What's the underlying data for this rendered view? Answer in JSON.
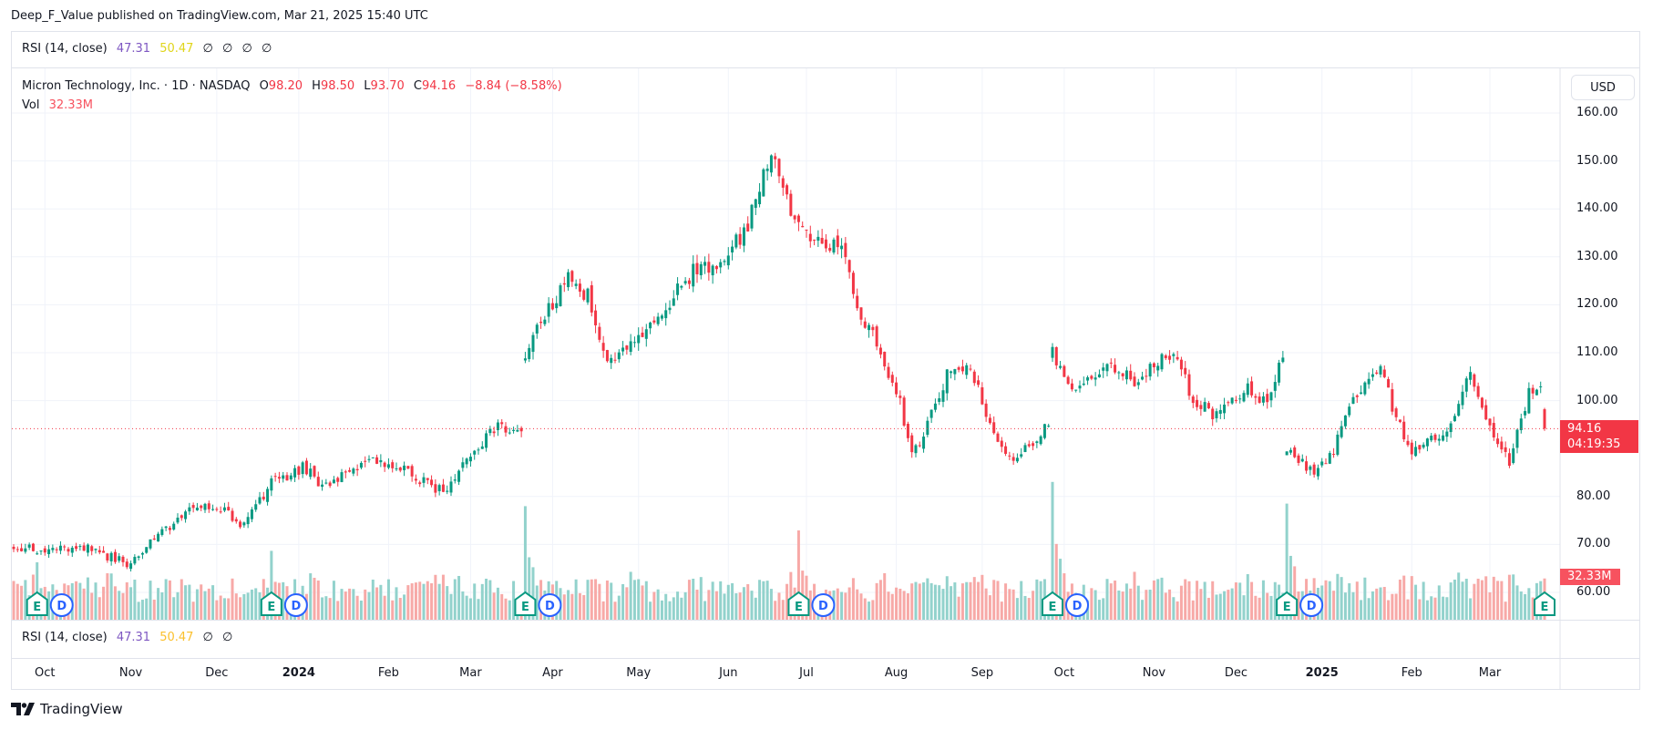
{
  "publisher_line": "Deep_F_Value published on TradingView.com, Mar 21, 2025 15:40 UTC",
  "rsi_top": {
    "label": "RSI (14, close)",
    "v1": "47.31",
    "v2": "50.47",
    "extras": [
      "∅",
      "∅",
      "∅",
      "∅"
    ]
  },
  "symbol": {
    "name": "Micron Technology, Inc. · 1D · NASDAQ",
    "o_label": "O",
    "o": "98.20",
    "h_label": "H",
    "h": "98.50",
    "l_label": "L",
    "l": "93.70",
    "c_label": "C",
    "c": "94.16",
    "change": "−8.84 (−8.58%)"
  },
  "volume_legend": {
    "label": "Vol",
    "value": "32.33M"
  },
  "currency": "USD",
  "last_price": {
    "price": "94.16",
    "countdown": "04:19:35"
  },
  "volume_badge": "32.33M",
  "rsi_bottom": {
    "label": "RSI (14, close)",
    "v1": "47.31",
    "v2": "50.47",
    "extras": [
      "∅",
      "∅"
    ]
  },
  "brand": "TradingView",
  "colors": {
    "up": "#089981",
    "down": "#f23645",
    "vol_up": "#92d2cc",
    "vol_down": "#f7a9a7",
    "earnings": "#089981",
    "dividend": "#2962ff"
  },
  "chart_data": {
    "type": "candlestick",
    "title": "Micron Technology, Inc. · 1D · NASDAQ",
    "ylim": [
      55,
      165
    ],
    "y_ticks": [
      "160.00",
      "150.00",
      "140.00",
      "130.00",
      "120.00",
      "110.00",
      "100.00",
      "80.00",
      "70.00",
      "60.00"
    ],
    "x_labels": [
      {
        "date": "2023-10",
        "label": "Oct"
      },
      {
        "date": "2023-11",
        "label": "Nov"
      },
      {
        "date": "2023-12",
        "label": "Dec"
      },
      {
        "date": "2024-01",
        "label": "2024",
        "bold": true
      },
      {
        "date": "2024-02",
        "label": "Feb"
      },
      {
        "date": "2024-03",
        "label": "Mar"
      },
      {
        "date": "2024-04",
        "label": "Apr"
      },
      {
        "date": "2024-05",
        "label": "May"
      },
      {
        "date": "2024-06",
        "label": "Jun"
      },
      {
        "date": "2024-07",
        "label": "Jul"
      },
      {
        "date": "2024-08",
        "label": "Aug"
      },
      {
        "date": "2024-09",
        "label": "Sep"
      },
      {
        "date": "2024-10",
        "label": "Oct"
      },
      {
        "date": "2024-11",
        "label": "Nov"
      },
      {
        "date": "2024-12",
        "label": "Dec"
      },
      {
        "date": "2025-01",
        "label": "2025",
        "bold": true
      },
      {
        "date": "2025-02",
        "label": "Feb"
      },
      {
        "date": "2025-03",
        "label": "Mar"
      }
    ],
    "date_range": [
      "2023-09-20",
      "2025-03-21"
    ],
    "close_anchors": [
      [
        "2023-09-20",
        70
      ],
      [
        "2023-09-28",
        68.5
      ],
      [
        "2023-10-16",
        69.5
      ],
      [
        "2023-10-31",
        66
      ],
      [
        "2023-11-10",
        72
      ],
      [
        "2023-11-22",
        77
      ],
      [
        "2023-12-01",
        78
      ],
      [
        "2023-12-12",
        74
      ],
      [
        "2023-12-21",
        83
      ],
      [
        "2024-01-02",
        86
      ],
      [
        "2024-01-10",
        82
      ],
      [
        "2024-01-26",
        88
      ],
      [
        "2024-02-06",
        86
      ],
      [
        "2024-02-21",
        81
      ],
      [
        "2024-03-01",
        88
      ],
      [
        "2024-03-12",
        95
      ],
      [
        "2024-03-20",
        93
      ],
      [
        "2024-03-21",
        110
      ],
      [
        "2024-03-28",
        118
      ],
      [
        "2024-04-05",
        125
      ],
      [
        "2024-04-12",
        122
      ],
      [
        "2024-04-19",
        108
      ],
      [
        "2024-04-30",
        112
      ],
      [
        "2024-05-10",
        120
      ],
      [
        "2024-05-21",
        127
      ],
      [
        "2024-06-03",
        130
      ],
      [
        "2024-06-10",
        137
      ],
      [
        "2024-06-18",
        152
      ],
      [
        "2024-06-26",
        138
      ],
      [
        "2024-07-05",
        133
      ],
      [
        "2024-07-12",
        133
      ],
      [
        "2024-07-18",
        120
      ],
      [
        "2024-07-26",
        110
      ],
      [
        "2024-08-02",
        100
      ],
      [
        "2024-08-07",
        88
      ],
      [
        "2024-08-20",
        105
      ],
      [
        "2024-08-28",
        107
      ],
      [
        "2024-09-06",
        91
      ],
      [
        "2024-09-12",
        87
      ],
      [
        "2024-09-25",
        95
      ],
      [
        "2024-09-26",
        110
      ],
      [
        "2024-10-04",
        101
      ],
      [
        "2024-10-15",
        108
      ],
      [
        "2024-10-25",
        104
      ],
      [
        "2024-11-08",
        110
      ],
      [
        "2024-11-15",
        100
      ],
      [
        "2024-11-25",
        97
      ],
      [
        "2024-12-05",
        103
      ],
      [
        "2024-12-12",
        99
      ],
      [
        "2024-12-18",
        109
      ],
      [
        "2024-12-19",
        89
      ],
      [
        "2024-12-31",
        85
      ],
      [
        "2025-01-06",
        90
      ],
      [
        "2025-01-10",
        100
      ],
      [
        "2025-01-22",
        108
      ],
      [
        "2025-01-28",
        96
      ],
      [
        "2025-02-03",
        90
      ],
      [
        "2025-02-14",
        94
      ],
      [
        "2025-02-24",
        106
      ],
      [
        "2025-03-04",
        92
      ],
      [
        "2025-03-10",
        87
      ],
      [
        "2025-03-17",
        102
      ],
      [
        "2025-03-20",
        102.7
      ]
    ],
    "last_candle": {
      "date": "2025-03-21",
      "open": 98.2,
      "high": 98.5,
      "low": 93.7,
      "close": 94.16,
      "volume_m": 32.33
    },
    "volume_spikes_m": [
      [
        "2023-09-28",
        45
      ],
      [
        "2023-12-21",
        54
      ],
      [
        "2024-03-21",
        89
      ],
      [
        "2024-06-27",
        70
      ],
      [
        "2024-09-26",
        108
      ],
      [
        "2024-12-19",
        91
      ]
    ],
    "earnings_dates": [
      "2023-09-28",
      "2023-12-21",
      "2024-03-21",
      "2024-06-27",
      "2024-09-26",
      "2024-12-19",
      "2025-03-21"
    ],
    "event_labels": {
      "earnings": "E",
      "dividend": "D"
    }
  }
}
